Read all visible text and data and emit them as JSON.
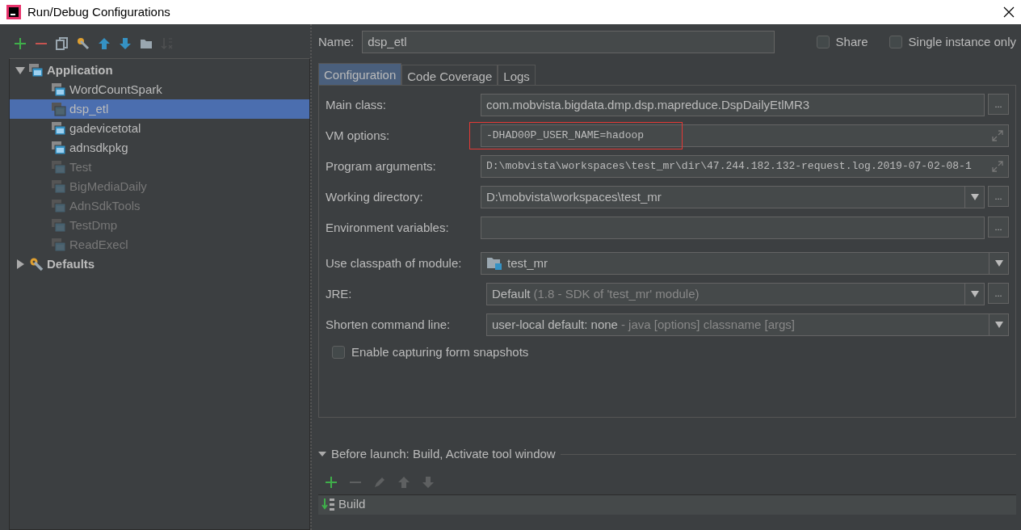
{
  "window": {
    "title": "Run/Debug Configurations"
  },
  "toolbar": [
    {
      "kind": "add",
      "disabled": false
    },
    {
      "kind": "remove",
      "disabled": false
    },
    {
      "kind": "copy",
      "disabled": false
    },
    {
      "kind": "edit-defaults",
      "disabled": false
    },
    {
      "kind": "move-up",
      "disabled": false
    },
    {
      "kind": "move-down",
      "disabled": false
    },
    {
      "kind": "folder",
      "disabled": false
    },
    {
      "kind": "sort",
      "disabled": true
    }
  ],
  "tree": [
    {
      "label": "Application",
      "kind": "application",
      "expanded": true,
      "selected": false,
      "children": [
        {
          "label": "WordCountSpark",
          "selected": false,
          "disabled": false
        },
        {
          "label": "dsp_etl",
          "selected": true,
          "disabled": false
        },
        {
          "label": "gadevicetotal",
          "selected": false,
          "disabled": false
        },
        {
          "label": "adnsdkpkg",
          "selected": false,
          "disabled": false
        },
        {
          "label": "Test",
          "selected": false,
          "disabled": true
        },
        {
          "label": "BigMediaDaily",
          "selected": false,
          "disabled": true
        },
        {
          "label": "AdnSdkTools",
          "selected": false,
          "disabled": true
        },
        {
          "label": "TestDmp",
          "selected": false,
          "disabled": true
        },
        {
          "label": "ReadExecl",
          "selected": false,
          "disabled": true
        }
      ]
    },
    {
      "label": "Defaults",
      "kind": "defaults",
      "expanded": false,
      "selected": false
    }
  ],
  "name_field": {
    "label": "Name:",
    "value": "dsp_etl"
  },
  "options": [
    {
      "label": "Share",
      "checked": false
    },
    {
      "label": "Single instance only",
      "checked": false
    }
  ],
  "tabs": [
    {
      "label": "Configuration",
      "selected": true
    },
    {
      "label": "Code Coverage",
      "selected": false
    },
    {
      "label": "Logs",
      "selected": false
    }
  ],
  "form": {
    "sections": [
      [
        {
          "label": "Main class:",
          "kind": "text",
          "value": "com.mobvista.bigdata.dmp.dsp.mapreduce.DspDailyEtlMR3",
          "browse": "...",
          "mono": false,
          "highlighted": false
        },
        {
          "label": "VM options:",
          "kind": "expandable",
          "value": "-DHAD00P_USER_NAME=hadoop",
          "mono": true,
          "highlighted": true
        },
        {
          "label": "Program arguments:",
          "kind": "expandable",
          "value": "D:\\mobvista\\workspaces\\test_mr\\dir\\47.244.182.132-request.log.2019-07-02-08-1",
          "mono": true,
          "highlighted": false
        },
        {
          "label": "Working directory:",
          "kind": "combo",
          "value": "D:\\mobvista\\workspaces\\test_mr",
          "browse": "...",
          "mono": false,
          "highlighted": false
        },
        {
          "label": "Environment variables:",
          "kind": "text",
          "browse": "...",
          "highlighted": false
        }
      ],
      [
        {
          "label": "Use classpath of module:",
          "kind": "module-combo",
          "value": "test_mr",
          "mono": false,
          "highlighted": false
        },
        {
          "label": "JRE:",
          "kind": "combo",
          "value": "Default",
          "hint": "(1.8 - SDK of 'test_mr' module)",
          "browse": "...",
          "mono": false,
          "highlighted": false
        },
        {
          "label": "Shorten command line:",
          "kind": "combo",
          "value": "user-local default: none",
          "hint": "- java [options] classname [args]",
          "mono": false,
          "highlighted": false
        }
      ]
    ],
    "checkbox": {
      "label": "Enable capturing form snapshots",
      "checked": false
    }
  },
  "before_launch": {
    "title": "Before launch: Build, Activate tool window",
    "expanded": true,
    "toolbar": [
      {
        "kind": "add",
        "disabled": false
      },
      {
        "kind": "remove",
        "disabled": true
      },
      {
        "kind": "edit",
        "disabled": true
      },
      {
        "kind": "move-up",
        "disabled": true
      },
      {
        "kind": "move-down",
        "disabled": true
      }
    ],
    "items": [
      {
        "label": "Build",
        "kind": "build"
      }
    ]
  }
}
